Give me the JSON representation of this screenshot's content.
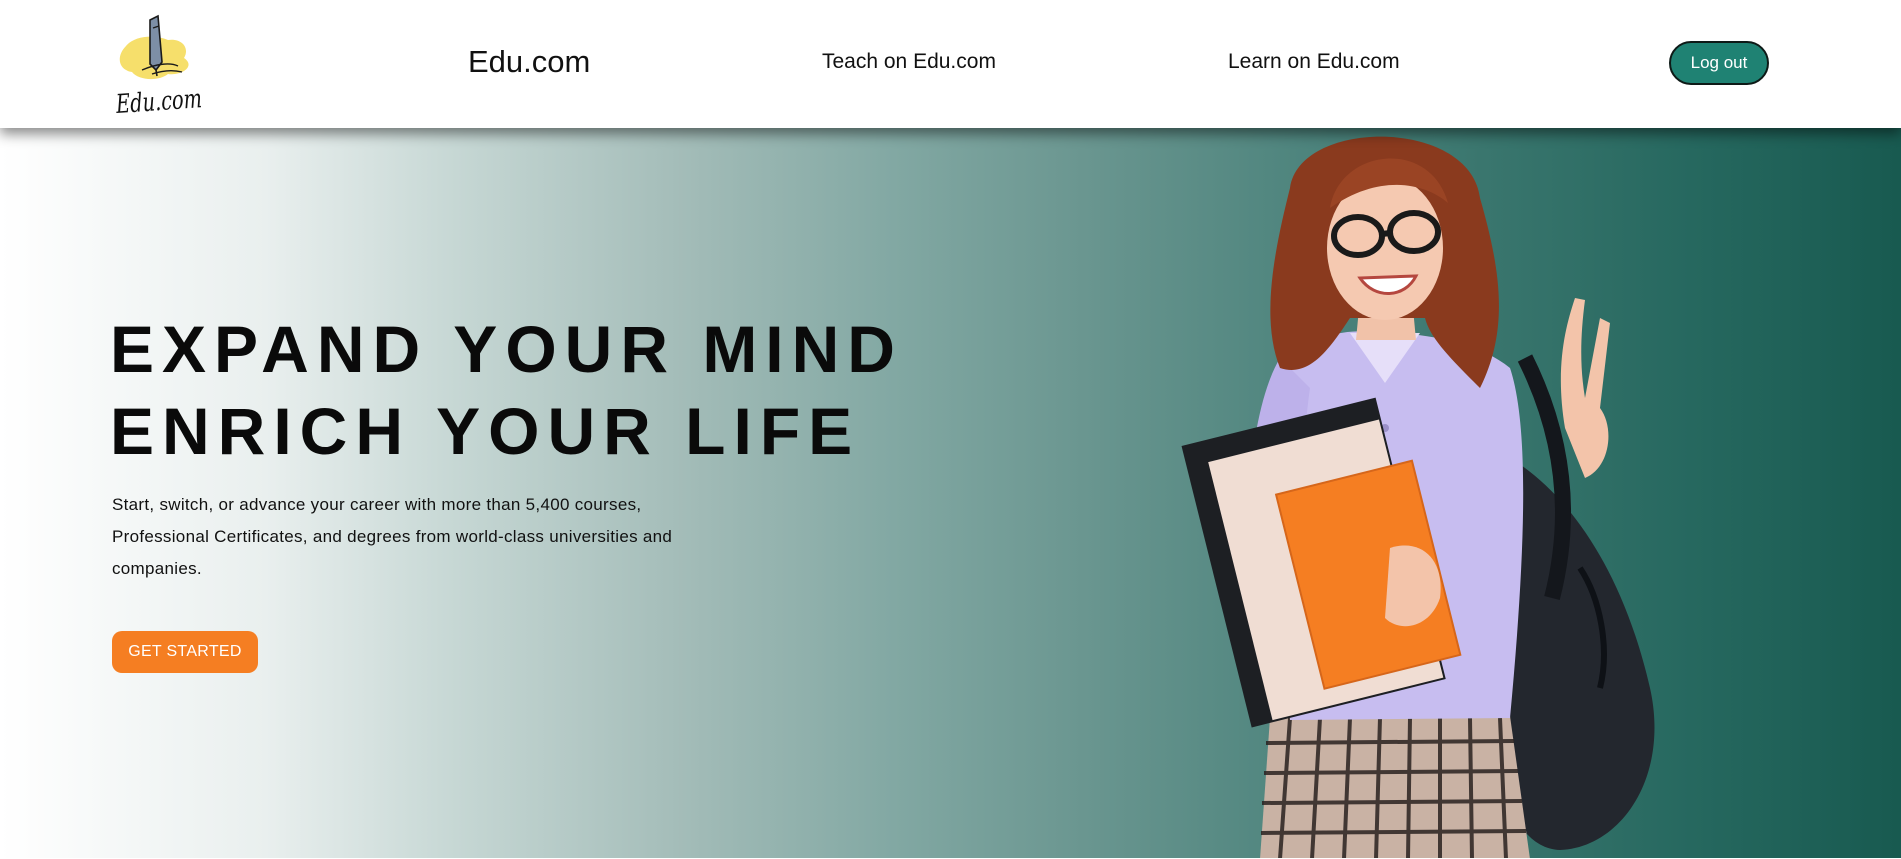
{
  "header": {
    "logo_text": "Edu.com",
    "brand_label": "Edu.com",
    "nav": {
      "teach_label": "Teach on Edu.com",
      "learn_label": "Learn on Edu.com"
    },
    "logout_label": "Log out"
  },
  "hero": {
    "headline_line1": "EXPAND YOUR MIND",
    "headline_line2": "ENRICH YOUR LIFE",
    "subtitle": "Start, switch, or advance your career with more than 5,400 courses, Professional Certificates, and degrees from world-class universities and companies.",
    "cta_label": "GET STARTED",
    "image_subject": "student-holding-notebooks-photo"
  },
  "colors": {
    "brand_teal": "#1f8273",
    "cta_orange": "#f57e22",
    "hero_gradient_end": "#185a50",
    "logo_yellow": "#f6df6b"
  }
}
